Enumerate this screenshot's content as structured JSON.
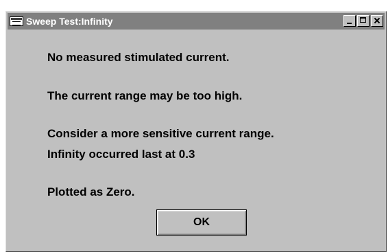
{
  "window": {
    "title": "Sweep Test:Infinity",
    "icon": "app-window-icon",
    "controls": {
      "minimize": "minimize-icon",
      "maximize": "maximize-icon",
      "close": "close-icon"
    }
  },
  "messages": {
    "line1": "No measured stimulated current.",
    "line2": "The current range may be too high.",
    "line3": "Consider a more sensitive current range.",
    "line4": "Infinity occurred last at 0.3",
    "line5": "Plotted as Zero."
  },
  "buttons": {
    "ok_label": "OK"
  },
  "colors": {
    "dialog_background": "#c0c0c0",
    "titlebar_background": "#808080",
    "title_text": "#ffffff"
  }
}
